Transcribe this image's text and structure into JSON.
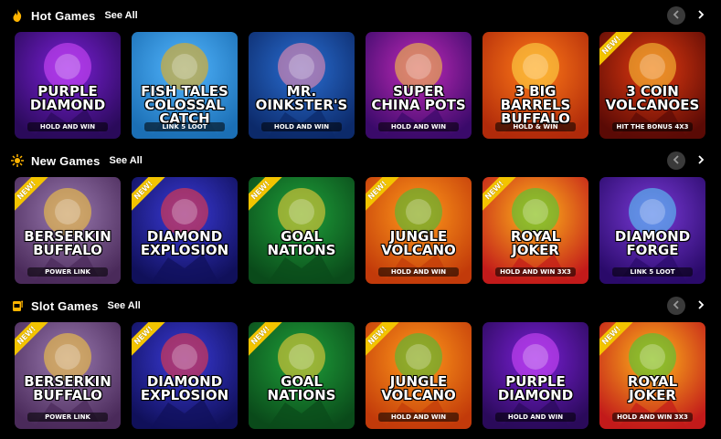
{
  "sections": [
    {
      "title": "Hot Games",
      "see_all": "See All",
      "icon": "flame-icon",
      "games": [
        {
          "title": "Purple Diamond",
          "subtitle": "Hold and Win",
          "new": false,
          "bg1": "#7a1fd6",
          "bg2": "#2a0a5a",
          "accent": "#d84cff"
        },
        {
          "title": "Fish Tales Colossal Catch",
          "subtitle": "Link 5 Loot",
          "new": false,
          "bg1": "#52b6ff",
          "bg2": "#1b6fb5",
          "accent": "#ffb000"
        },
        {
          "title": "Mr. Oinkster's",
          "subtitle": "Hold and Win",
          "new": false,
          "bg1": "#2a6fd4",
          "bg2": "#0c2a6a",
          "accent": "#ff8fb0"
        },
        {
          "title": "Super China Pots",
          "subtitle": "Hold and Win",
          "new": false,
          "bg1": "#c02ab8",
          "bg2": "#3a0a6a",
          "accent": "#ffcf3a"
        },
        {
          "title": "3 Big Barrels Buffalo",
          "subtitle": "Hold & Win",
          "new": false,
          "bg1": "#ff7a18",
          "bg2": "#b02a0a",
          "accent": "#ffe14a"
        },
        {
          "title": "3 Coin Volcanoes",
          "subtitle": "Hit the Bonus 4x3",
          "new": true,
          "bg1": "#e23a10",
          "bg2": "#5a0a05",
          "accent": "#ffd23a"
        }
      ]
    },
    {
      "title": "New Games",
      "see_all": "See All",
      "icon": "sparkle-icon",
      "games": [
        {
          "title": "Berserkin Buffalo",
          "subtitle": "Power Link",
          "new": true,
          "bg1": "#9a7ab0",
          "bg2": "#4a2a5a",
          "accent": "#ffcf3a"
        },
        {
          "title": "Diamond Explosion",
          "subtitle": "",
          "new": true,
          "bg1": "#3a3ad8",
          "bg2": "#10105a",
          "accent": "#ff3a3a"
        },
        {
          "title": "Goal Nations",
          "subtitle": "",
          "new": true,
          "bg1": "#1fa03a",
          "bg2": "#0a4a1a",
          "accent": "#ffd23a"
        },
        {
          "title": "Jungle Volcano",
          "subtitle": "Hold and Win",
          "new": true,
          "bg1": "#ff9a1a",
          "bg2": "#c23a0a",
          "accent": "#3ac23a"
        },
        {
          "title": "Royal Joker",
          "subtitle": "Hold and Win 3x3",
          "new": true,
          "bg1": "#ffb81a",
          "bg2": "#c21a1a",
          "accent": "#3ad03a"
        },
        {
          "title": "Diamond Forge",
          "subtitle": "Link 5 Loot",
          "new": false,
          "bg1": "#7a3ad8",
          "bg2": "#2a0a6a",
          "accent": "#5ad8ff"
        }
      ]
    },
    {
      "title": "Slot Games",
      "see_all": "See All",
      "icon": "slot-machine-icon",
      "games": [
        {
          "title": "Berserkin Buffalo",
          "subtitle": "Power Link",
          "new": true,
          "bg1": "#9a7ab0",
          "bg2": "#4a2a5a",
          "accent": "#ffcf3a"
        },
        {
          "title": "Diamond Explosion",
          "subtitle": "",
          "new": true,
          "bg1": "#3a3ad8",
          "bg2": "#10105a",
          "accent": "#ff3a3a"
        },
        {
          "title": "Goal Nations",
          "subtitle": "",
          "new": true,
          "bg1": "#1fa03a",
          "bg2": "#0a4a1a",
          "accent": "#ffd23a"
        },
        {
          "title": "Jungle Volcano",
          "subtitle": "Hold and Win",
          "new": true,
          "bg1": "#ff9a1a",
          "bg2": "#c23a0a",
          "accent": "#3ac23a"
        },
        {
          "title": "Purple Diamond",
          "subtitle": "Hold and Win",
          "new": false,
          "bg1": "#7a1fd6",
          "bg2": "#2a0a5a",
          "accent": "#d84cff"
        },
        {
          "title": "Royal Joker",
          "subtitle": "Hold and Win 3x3",
          "new": true,
          "bg1": "#ffb81a",
          "bg2": "#c21a1a",
          "accent": "#3ad03a"
        }
      ]
    }
  ],
  "new_badge_label": "NEW!",
  "colors": {
    "background": "#000000",
    "arrow_bg": "#3a3a3a",
    "badge": "#f3c400"
  }
}
